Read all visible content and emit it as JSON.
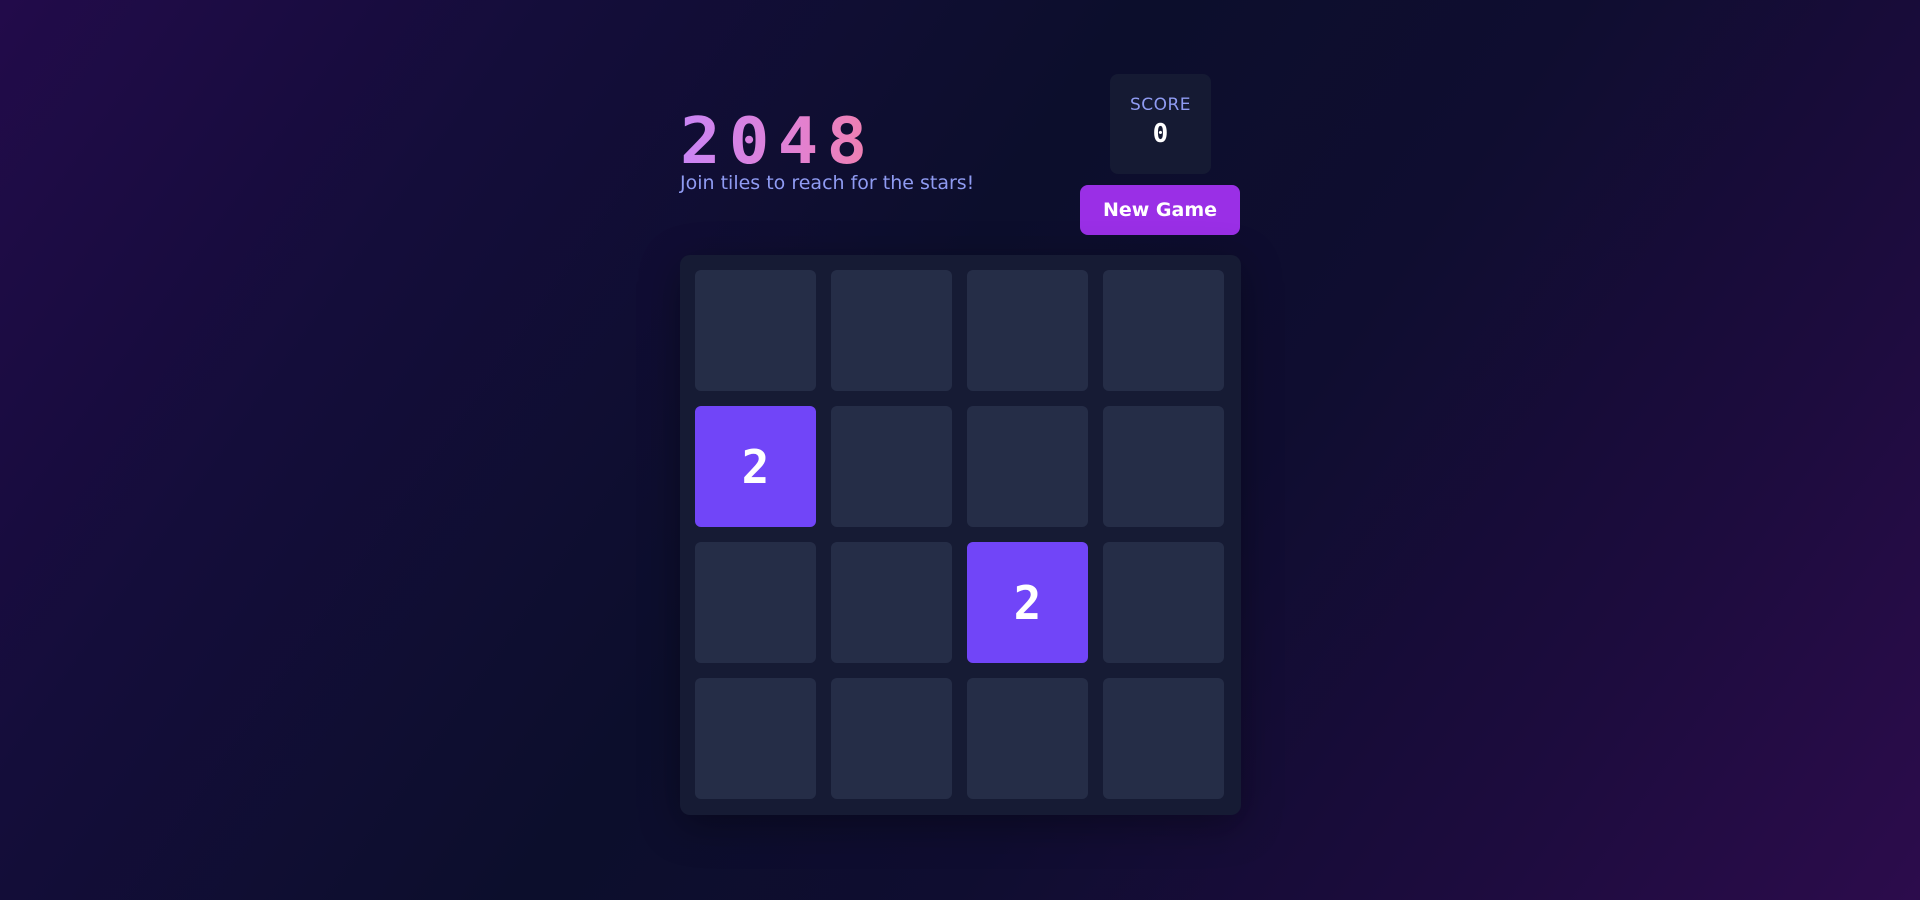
{
  "header": {
    "title": "2048",
    "subtitle": "Join tiles to reach for the stars!"
  },
  "score": {
    "label": "SCORE",
    "value": "0"
  },
  "controls": {
    "new_game_label": "New Game"
  },
  "board": {
    "size": 4,
    "cells": [
      "",
      "",
      "",
      "",
      "2",
      "",
      "",
      "",
      "",
      "",
      "2",
      "",
      "",
      "",
      "",
      ""
    ]
  },
  "colors": {
    "tile_2": "#7145f8",
    "empty_cell": "#252d47",
    "board_bg": "#161b34",
    "button": "#9a2fe6",
    "accent_text": "#8f9bf2"
  }
}
